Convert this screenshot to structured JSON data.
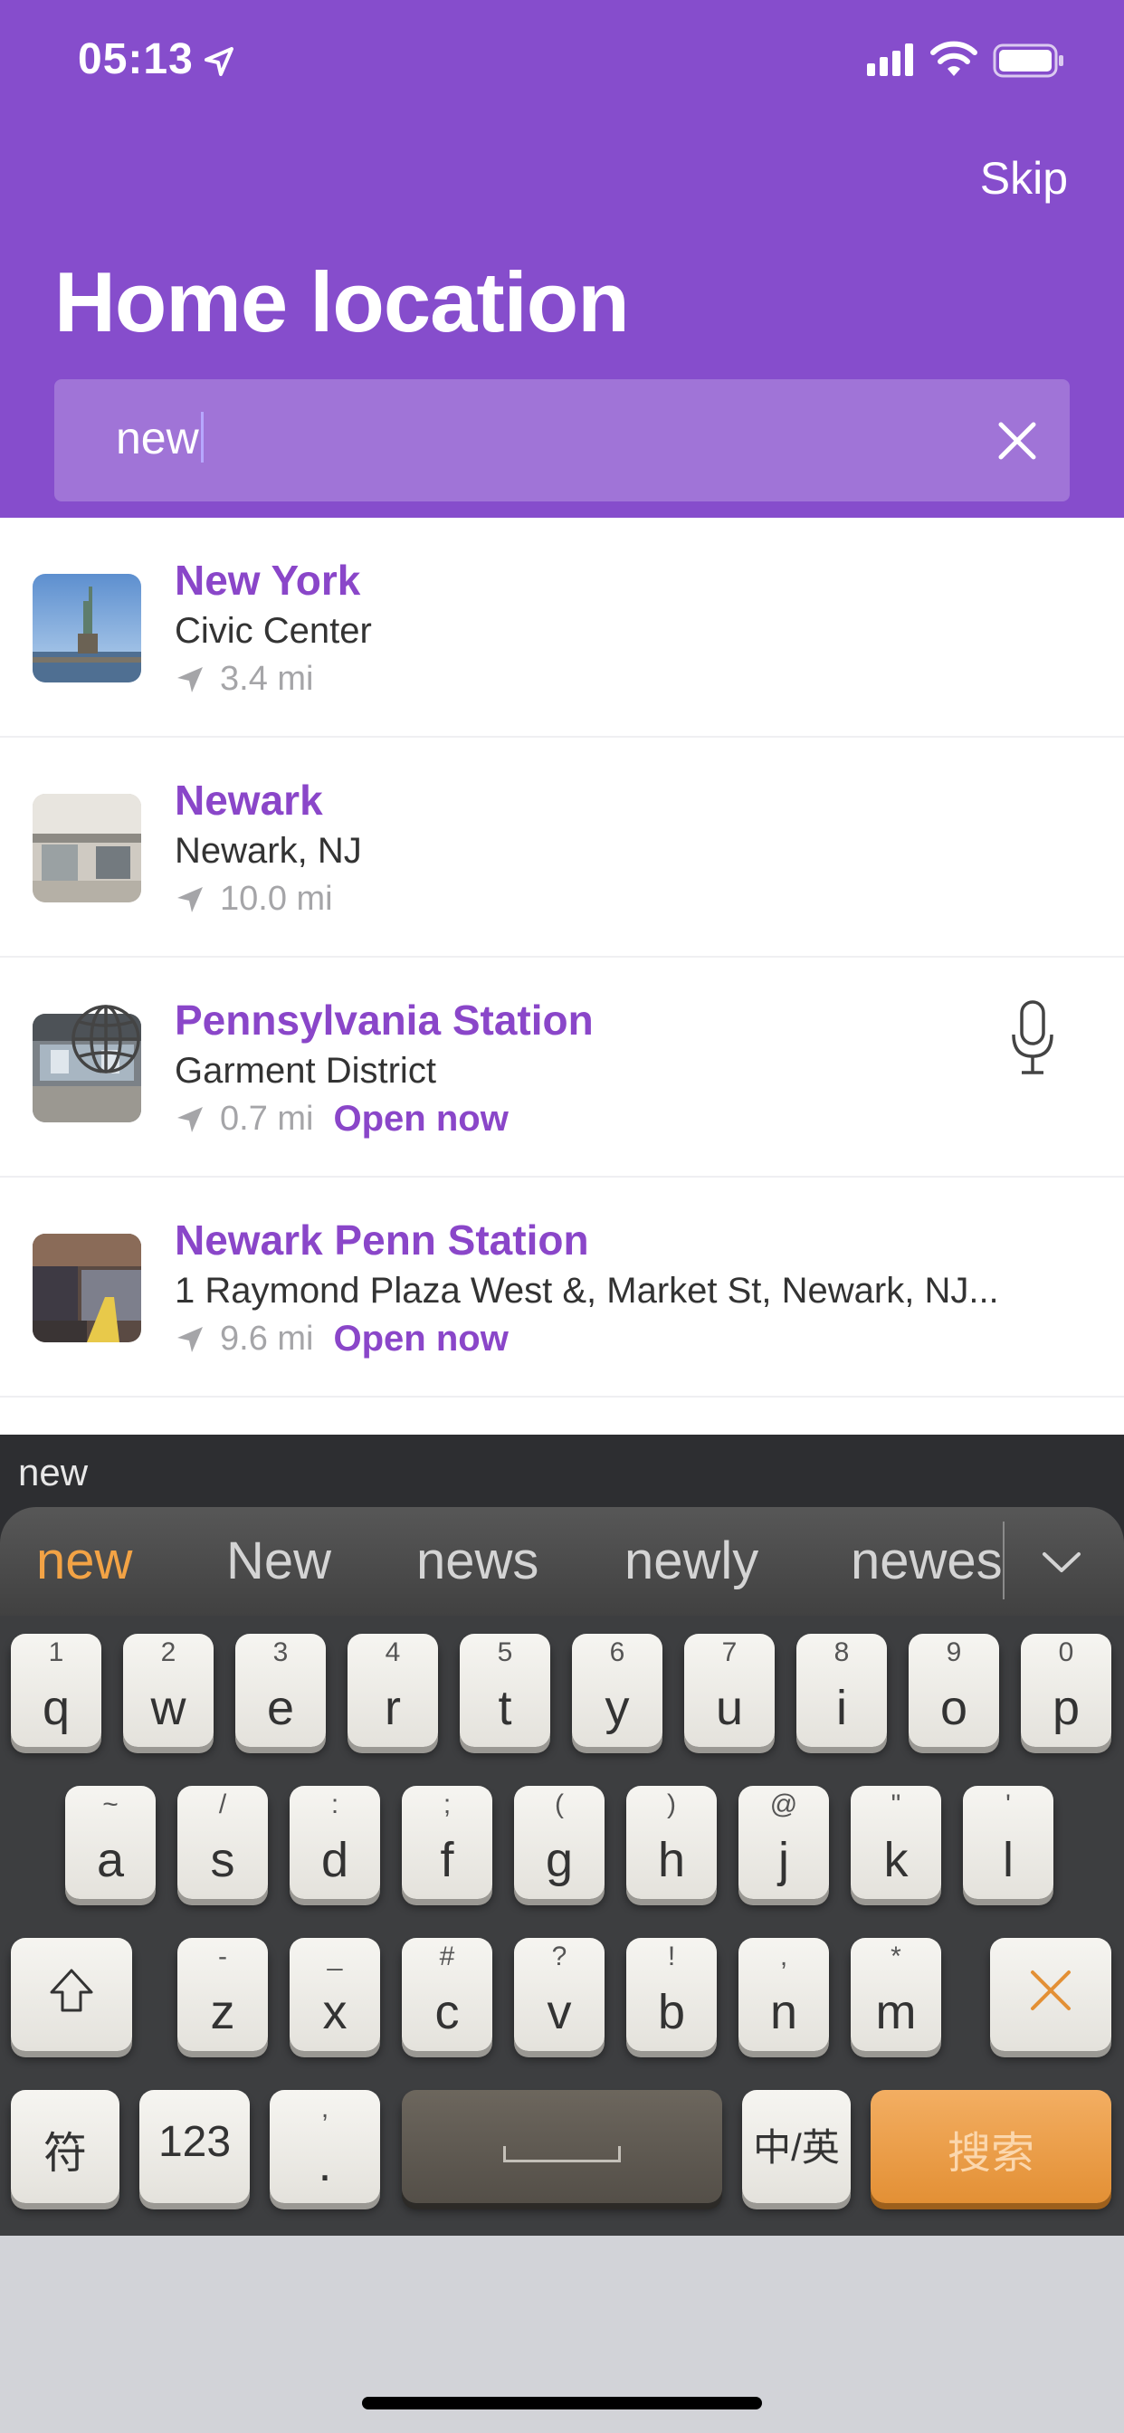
{
  "status_bar": {
    "time": "05:13"
  },
  "header": {
    "skip_label": "Skip",
    "title": "Home location",
    "search": {
      "value": "new"
    },
    "colors": {
      "background": "#864dcc",
      "accent_text": "#8a46c9"
    }
  },
  "results": [
    {
      "name": "New York",
      "subtitle": "Civic Center",
      "distance": "3.4 mi",
      "open": ""
    },
    {
      "name": "Newark",
      "subtitle": "Newark, NJ",
      "distance": "10.0 mi",
      "open": ""
    },
    {
      "name": "Pennsylvania Station",
      "subtitle": "Garment District",
      "distance": "0.7 mi",
      "open": "Open now"
    },
    {
      "name": "Newark Penn Station",
      "subtitle": "1 Raymond Plaza West &, Market St, Newark, NJ...",
      "distance": "9.6 mi",
      "open": "Open now"
    }
  ],
  "keyboard": {
    "composing": "new",
    "candidates": [
      "new",
      "New",
      "news",
      "newly",
      "newes"
    ],
    "row1": [
      {
        "sup": "1",
        "main": "q"
      },
      {
        "sup": "2",
        "main": "w"
      },
      {
        "sup": "3",
        "main": "e"
      },
      {
        "sup": "4",
        "main": "r"
      },
      {
        "sup": "5",
        "main": "t"
      },
      {
        "sup": "6",
        "main": "y"
      },
      {
        "sup": "7",
        "main": "u"
      },
      {
        "sup": "8",
        "main": "i"
      },
      {
        "sup": "9",
        "main": "o"
      },
      {
        "sup": "0",
        "main": "p"
      }
    ],
    "row2": [
      {
        "sup": "~",
        "main": "a"
      },
      {
        "sup": "/",
        "main": "s"
      },
      {
        "sup": ":",
        "main": "d"
      },
      {
        "sup": ";",
        "main": "f"
      },
      {
        "sup": "(",
        "main": "g"
      },
      {
        "sup": ")",
        "main": "h"
      },
      {
        "sup": "@",
        "main": "j"
      },
      {
        "sup": "\"",
        "main": "k"
      },
      {
        "sup": "'",
        "main": "l"
      }
    ],
    "row3": [
      {
        "sup": "-",
        "main": "z"
      },
      {
        "sup": "_",
        "main": "x"
      },
      {
        "sup": "#",
        "main": "c"
      },
      {
        "sup": "?",
        "main": "v"
      },
      {
        "sup": "!",
        "main": "b"
      },
      {
        "sup": ",",
        "main": "n"
      },
      {
        "sup": "*",
        "main": "m"
      }
    ],
    "symbols_label": "符",
    "numbers_label": "123",
    "punct_sup": ",",
    "punct_main": ".",
    "lang_label": "中/英",
    "search_label": "搜索",
    "icons": {
      "shift": "shift-icon",
      "delete": "delete-x-icon",
      "globe": "globe-icon",
      "mic": "microphone-icon",
      "expand": "chevron-down-icon"
    },
    "colors": {
      "active_candidate": "#f3a345",
      "search_key": "#eb9d45"
    }
  }
}
